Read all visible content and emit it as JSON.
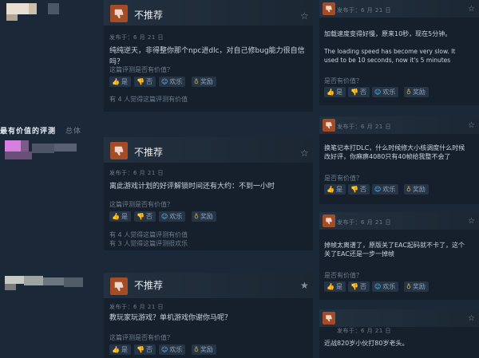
{
  "section": {
    "title": "最有价值的评测",
    "subtitle": "总体"
  },
  "left_reviews": [
    {
      "verdict": "不推荐",
      "posted": "发布于：6 月 21 日",
      "text": "纯纯逆天，非得整你那个npc进dlc，对自己修bug能力很自信吗？",
      "helpful_question": "这篇评测是否有价值？",
      "buttons": {
        "yes": "是",
        "no": "否",
        "funny": "欢乐",
        "award": "奖励"
      },
      "stats": [
        "有 4 人觉得这篇评测有价值"
      ]
    },
    {
      "verdict": "不推荐",
      "posted": "发布于：6 月 21 日",
      "text": "离此游戏计划的好评解锁时间还有大约：不到一小时",
      "helpful_question": "这篇评测是否有价值？",
      "buttons": {
        "yes": "是",
        "no": "否",
        "funny": "欢乐",
        "award": "奖励"
      },
      "stats": [
        "有 4 人觉得这篇评测有价值",
        "有 3 人觉得这篇评测很欢乐"
      ]
    },
    {
      "verdict": "不推荐",
      "posted": "发布于：6 月 21 日",
      "text": "教玩家玩游戏？单机游戏你谢你马呢？",
      "helpful_question": "这篇评测是否有价值？",
      "buttons": {
        "yes": "是",
        "no": "否",
        "funny": "欢乐",
        "award": "奖励"
      },
      "stats": []
    }
  ],
  "right_reviews": [
    {
      "posted": "发布于：6 月 21 日",
      "text_lines": [
        "加载速度变得好慢，原来10秒，现在5分钟。",
        "",
        "The loading speed has become very slow. It",
        "used to be 10 seconds, now it's 5 minutes"
      ],
      "helpful_question": "是否有价值？",
      "buttons": {
        "yes": "是",
        "no": "否",
        "funny": "欢乐",
        "award": "奖励"
      }
    },
    {
      "posted": "发布于：6 月 21 日",
      "text_lines": [
        "换笔记本打DLC，什么时候修大小核调度什么时候",
        "改好评，你麻痹4080只有40帧给我整不会了"
      ],
      "helpful_question": "是否有价值？",
      "buttons": {
        "yes": "是",
        "no": "否",
        "funny": "欢乐",
        "award": "奖励"
      }
    },
    {
      "posted": "发布于：6 月 21 日",
      "text_lines": [
        "掉帧太离谱了，原版关了EAC起码就不卡了，这个",
        "关了EAC还是一步一掉帧"
      ],
      "helpful_question": "是否有价值？",
      "buttons": {
        "yes": "是",
        "no": "否",
        "funny": "欢乐",
        "award": "奖励"
      }
    },
    {
      "posted": "发布于：6 月 21 日",
      "text_lines": [
        "近战820岁小伙打80岁老头。"
      ],
      "helpful_question": "",
      "buttons": {}
    }
  ],
  "icons": {
    "thumbs_down": "thumbs-down-icon",
    "thumbs_up": "thumbs-up-icon",
    "favorite": "star-icon",
    "funny": "smile-icon",
    "award": "award-icon"
  },
  "colors": {
    "background": "#1b2838",
    "review_panel": "#16202d",
    "not_recommended": "#a34c25",
    "link_blue": "#66c0f4"
  }
}
